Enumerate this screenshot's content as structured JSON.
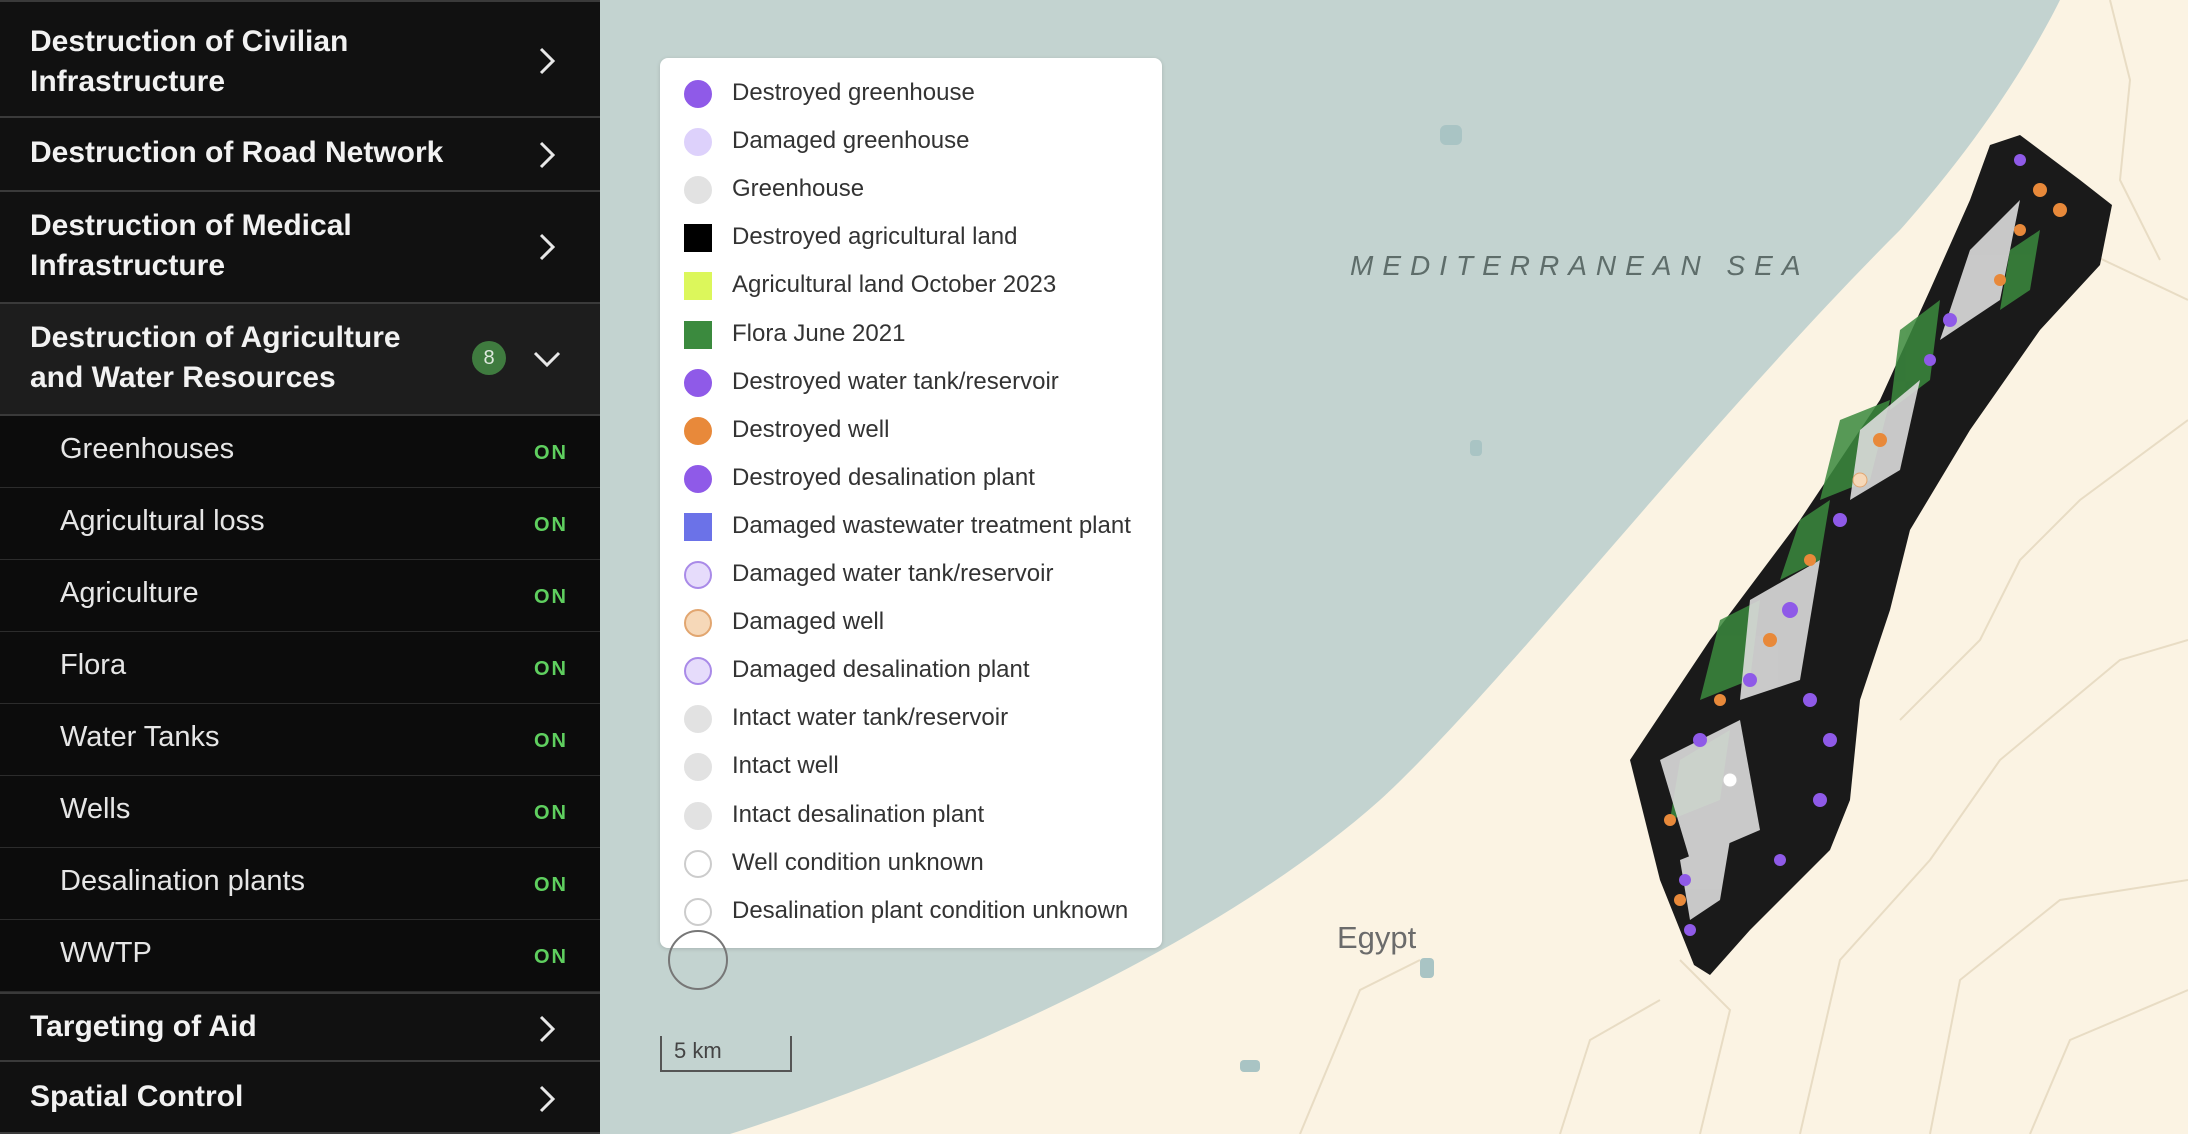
{
  "sidebar": {
    "categories": [
      {
        "title": "Destruction of Civilian Infrastructure",
        "lines": [
          "Destruction of Civilian",
          "Infrastructure"
        ]
      },
      {
        "title": "Destruction of Road Network",
        "lines": [
          "Destruction of Road Network"
        ]
      },
      {
        "title": "Destruction of Medical Infrastructure",
        "lines": [
          "Destruction of Medical",
          "Infrastructure"
        ]
      },
      {
        "title": "Destruction of Agriculture and Water Resources",
        "lines": [
          "Destruction of Agriculture",
          "and Water Resources"
        ],
        "badge": "8"
      },
      {
        "title": "Targeting of Aid",
        "lines": [
          "Targeting of Aid"
        ]
      },
      {
        "title": "Spatial Control",
        "lines": [
          "Spatial Control"
        ]
      }
    ],
    "sub_items": [
      {
        "label": "Greenhouses",
        "status": "ON"
      },
      {
        "label": "Agricultural loss",
        "status": "ON"
      },
      {
        "label": "Agriculture",
        "status": "ON"
      },
      {
        "label": "Flora",
        "status": "ON"
      },
      {
        "label": "Water Tanks",
        "status": "ON"
      },
      {
        "label": "Wells",
        "status": "ON"
      },
      {
        "label": "Desalination plants",
        "status": "ON"
      },
      {
        "label": "WWTP",
        "status": "ON"
      }
    ]
  },
  "map": {
    "sea_label": "MEDITERRANEAN SEA",
    "country_label": "Egypt",
    "scale_label": "5 km",
    "colors": {
      "sea": "#c3d3d0",
      "land": "#fdf5e6",
      "agri_destroyed": "#000000",
      "flora": "#3b8a3e",
      "destroyed_purple": "#8f5ae8",
      "destroyed_orange": "#e8893a",
      "greenhouse_grey": "#e2e2e2"
    }
  },
  "legend": {
    "items": [
      {
        "label": "Destroyed greenhouse",
        "shape": "circle",
        "fill": "#8f5ae8",
        "stroke": "#8f5ae8"
      },
      {
        "label": "Damaged greenhouse",
        "shape": "circle",
        "fill": "#ddd1fb",
        "stroke": "#ddd1fb"
      },
      {
        "label": "Greenhouse",
        "shape": "circle",
        "fill": "#e2e2e2",
        "stroke": "#e2e2e2"
      },
      {
        "label": "Destroyed agricultural land",
        "shape": "square",
        "fill": "#000000",
        "stroke": "#000000"
      },
      {
        "label": "Agricultural land October 2023",
        "shape": "square",
        "fill": "#dcf75b",
        "stroke": "#dcf75b"
      },
      {
        "label": "Flora June 2021",
        "shape": "square",
        "fill": "#3b8a3e",
        "stroke": "#3b8a3e"
      },
      {
        "label": "Destroyed water tank/reservoir",
        "shape": "circle",
        "fill": "#8f5ae8",
        "stroke": "#8f5ae8"
      },
      {
        "label": "Destroyed well",
        "shape": "circle",
        "fill": "#e8893a",
        "stroke": "#e8893a"
      },
      {
        "label": "Destroyed desalination plant",
        "shape": "circle",
        "fill": "#8f5ae8",
        "stroke": "#8f5ae8"
      },
      {
        "label": "Damaged wastewater treatment plant",
        "shape": "square",
        "fill": "#6b72e8",
        "stroke": "#6b72e8"
      },
      {
        "label": "Damaged water tank/reservoir",
        "shape": "circle",
        "fill": "#e6dcfb",
        "stroke": "#a98ae8"
      },
      {
        "label": "Damaged well",
        "shape": "circle",
        "fill": "#f6d8b8",
        "stroke": "#e2a670"
      },
      {
        "label": "Damaged desalination plant",
        "shape": "circle",
        "fill": "#e6dcfb",
        "stroke": "#a98ae8"
      },
      {
        "label": "Intact water tank/reservoir",
        "shape": "circle",
        "fill": "#e2e2e2",
        "stroke": "#e2e2e2"
      },
      {
        "label": "Intact well",
        "shape": "circle",
        "fill": "#e2e2e2",
        "stroke": "#e2e2e2"
      },
      {
        "label": "Intact desalination plant",
        "shape": "circle",
        "fill": "#e2e2e2",
        "stroke": "#e2e2e2"
      },
      {
        "label": "Well condition unknown",
        "shape": "circle",
        "fill": "#ffffff",
        "stroke": "#cccccc"
      },
      {
        "label": "Desalination plant condition unknown",
        "shape": "circle",
        "fill": "#ffffff",
        "stroke": "#cccccc"
      }
    ]
  }
}
